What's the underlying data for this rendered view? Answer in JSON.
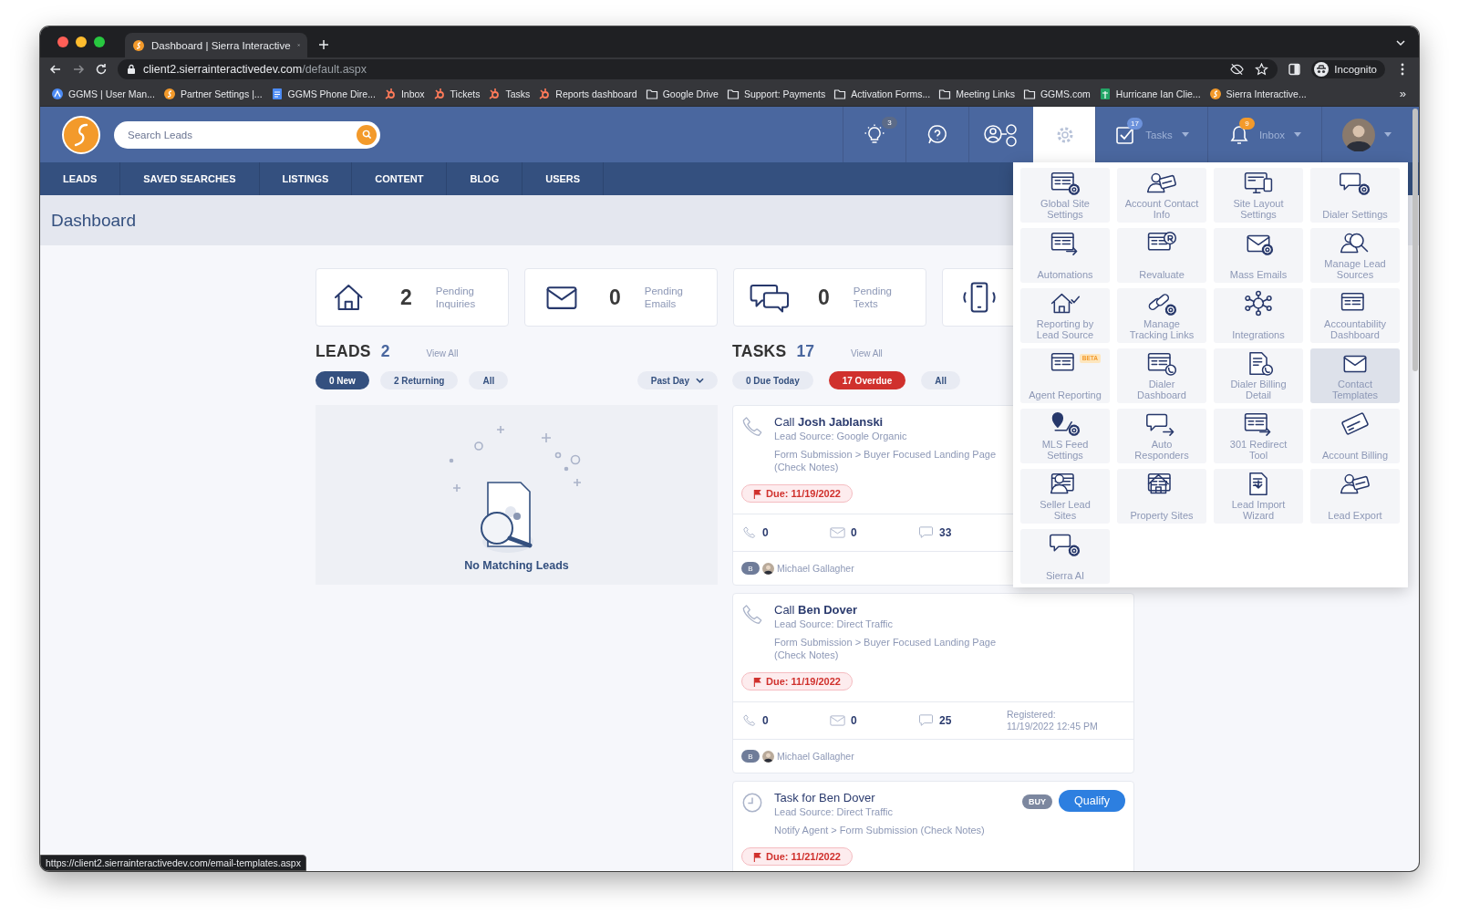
{
  "browser": {
    "tabs": [
      {
        "title": "Dashboard | Sierra Interactive",
        "selected": true
      }
    ],
    "url": {
      "host": "client2.sierrainteractivedev.com",
      "path": "/default.aspx"
    },
    "profile": "Incognito",
    "bookmarks": [
      {
        "label": "GGMS | User Man...",
        "kind": "app"
      },
      {
        "label": "Partner Settings |...",
        "kind": "sierra"
      },
      {
        "label": "GGMS Phone Dire...",
        "kind": "doc"
      },
      {
        "label": "Inbox",
        "kind": "hub"
      },
      {
        "label": "Tickets",
        "kind": "hub"
      },
      {
        "label": "Tasks",
        "kind": "hub"
      },
      {
        "label": "Reports dashboard",
        "kind": "hub"
      },
      {
        "label": "Google Drive",
        "kind": "folder"
      },
      {
        "label": "Support: Payments",
        "kind": "folder"
      },
      {
        "label": "Activation Forms...",
        "kind": "folder"
      },
      {
        "label": "Meeting Links",
        "kind": "folder"
      },
      {
        "label": "GGMS.com",
        "kind": "folder"
      },
      {
        "label": "Hurricane Ian Clie...",
        "kind": "sheet"
      },
      {
        "label": "Sierra Interactive...",
        "kind": "sierra"
      }
    ],
    "more_bookmarks": "»",
    "status_url": "https://client2.sierrainteractivedev.com/email-templates.aspx"
  },
  "header": {
    "search_placeholder": "Search Leads",
    "ideas_count": "3",
    "tasks": {
      "label": "Tasks",
      "count": "17"
    },
    "inbox": {
      "label": "Inbox",
      "count": "9"
    },
    "settings_open": true
  },
  "nav": [
    {
      "label": "LEADS"
    },
    {
      "label": "SAVED SEARCHES"
    },
    {
      "label": "LISTINGS"
    },
    {
      "label": "CONTENT"
    },
    {
      "label": "BLOG"
    },
    {
      "label": "USERS"
    }
  ],
  "page_title": "Dashboard",
  "stats": [
    {
      "kind": "inquiries",
      "count": "2",
      "label": "Pending Inquiries"
    },
    {
      "kind": "emails",
      "count": "0",
      "label": "Pending Emails"
    },
    {
      "kind": "texts",
      "count": "0",
      "label": "Pending Texts"
    },
    {
      "kind": "calls"
    }
  ],
  "leads": {
    "title": "LEADS",
    "count": "2",
    "view_all": "View All",
    "filters": [
      {
        "label": "0 New",
        "selected": true
      },
      {
        "label": "2 Returning",
        "selected": false
      },
      {
        "label": "All",
        "selected": false
      }
    ],
    "period": "Past Day",
    "empty_text": "No Matching Leads"
  },
  "tasks": {
    "title": "TASKS",
    "count": "17",
    "view_all": "View All",
    "filters": [
      {
        "label": "0 Due Today",
        "selected": false
      },
      {
        "label": "17 Overdue",
        "selected": true
      },
      {
        "label": "All",
        "selected": false
      }
    ],
    "items": [
      {
        "kind": "call",
        "title": "Call **Josh Jablanski**",
        "source": "Lead Source: Google Organic",
        "note": "Form Submission > Buyer Focused Landing Page (Check Notes)",
        "due": "Due: 11/19/2022",
        "calls": "0",
        "emails": "0",
        "texts": "33",
        "agent_initial": "B",
        "agent": "Michael Gallagher"
      },
      {
        "kind": "call",
        "title": "Call **Ben Dover**",
        "source": "Lead Source: Direct Traffic",
        "note": "Form Submission > Buyer Focused Landing Page (Check Notes)",
        "due": "Due: 11/19/2022",
        "calls": "0",
        "emails": "0",
        "texts": "25",
        "registered_label": "Registered:",
        "registered": "11/19/2022 12:45 PM",
        "agent_initial": "B",
        "agent": "Michael Gallagher"
      },
      {
        "kind": "task",
        "title": "Task for Ben Dover",
        "source": "Lead Source: Direct Traffic",
        "note": "Notify Agent > Form Submission (Check Notes)",
        "due": "Due: 11/21/2022",
        "tag": "BUY",
        "action": "Qualify"
      }
    ]
  },
  "settings_menu": {
    "items": [
      {
        "label": "Global Site Settings",
        "selected": false
      },
      {
        "label": "Account Contact Info",
        "selected": false
      },
      {
        "label": "Site Layout Settings",
        "selected": false
      },
      {
        "label": "Dialer Settings",
        "selected": false
      },
      {
        "label": "Automations",
        "selected": false
      },
      {
        "label": "Revaluate",
        "selected": false
      },
      {
        "label": "Mass Emails",
        "selected": false
      },
      {
        "label": "Manage Lead Sources",
        "selected": false
      },
      {
        "label": "Reporting by Lead Source",
        "selected": false
      },
      {
        "label": "Manage Tracking Links",
        "selected": false
      },
      {
        "label": "Integrations",
        "selected": false
      },
      {
        "label": "Accountability Dashboard",
        "selected": false
      },
      {
        "label": "Agent Reporting",
        "selected": false,
        "badge": "BETA"
      },
      {
        "label": "Dialer Dashboard",
        "selected": false
      },
      {
        "label": "Dialer Billing Detail",
        "selected": false
      },
      {
        "label": "Contact Templates",
        "selected": true
      },
      {
        "label": "MLS Feed Settings",
        "selected": false
      },
      {
        "label": "Auto Responders",
        "selected": false
      },
      {
        "label": "301 Redirect Tool",
        "selected": false
      },
      {
        "label": "Account Billing",
        "selected": false
      },
      {
        "label": "Seller Lead Sites",
        "selected": false
      },
      {
        "label": "Property Sites",
        "selected": false
      },
      {
        "label": "Lead Import Wizard",
        "selected": false
      },
      {
        "label": "Lead Export",
        "selected": false
      },
      {
        "label": "Sierra AI",
        "selected": false
      }
    ]
  }
}
